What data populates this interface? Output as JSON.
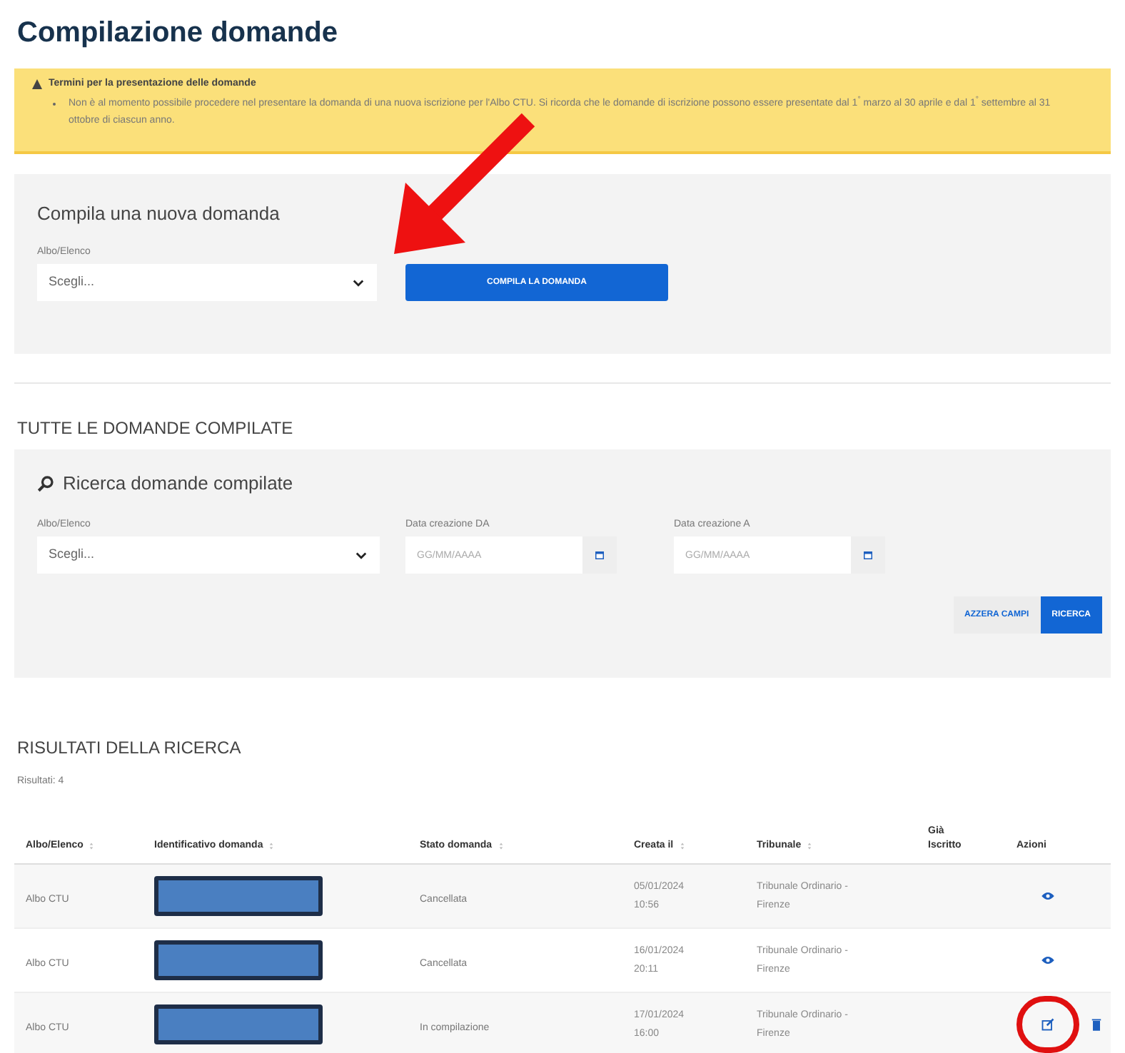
{
  "page_title": "Compilazione domande",
  "notice": {
    "title": "Termini per la presentazione delle domande",
    "text": "Non è al momento possibile procedere nel presentare la domanda di una nuova iscrizione per l'Albo CTU. Si ricorda che le domande di iscrizione possono essere presentate dal 1$^{°}$ marzo al 30 aprile e dal 1$^{°}$ settembre al 31 ottobre di ciascun anno."
  },
  "new_form": {
    "title": "Compila una nuova domanda",
    "select_label": "Albo/Elenco",
    "select_value": "Scegli...",
    "button": "COMPILA LA DOMANDA"
  },
  "search_section_title": "TUTTE LE DOMANDE COMPILATE",
  "search": {
    "title": "Ricerca domande compilate",
    "fields": [
      {
        "kind": "select",
        "label": "Albo/Elenco",
        "value": "Scegli..."
      },
      {
        "kind": "date",
        "label": "Data creazione DA",
        "placeholder": "GG/MM/AAAA"
      },
      {
        "kind": "date",
        "label": "Data creazione A",
        "placeholder": "GG/MM/AAAA"
      }
    ],
    "buttons": [
      {
        "label": "AZZERA CAMPI",
        "kind": "secondary"
      },
      {
        "label": "RICERCA",
        "kind": "primary"
      }
    ]
  },
  "results": {
    "title": "RISULTATI DELLA RICERCA",
    "count": "Risultati: 4",
    "columns": [
      {
        "label": "Albo/Elenco",
        "sortable": true
      },
      {
        "label": "Identificativo domanda",
        "sortable": true
      },
      {
        "label": "Stato domanda",
        "sortable": true
      },
      {
        "label": "Creata il",
        "sortable": true
      },
      {
        "label": "Tribunale",
        "sortable": true
      },
      {
        "label": "Già Iscritto",
        "sortable": false
      },
      {
        "label": "Azioni",
        "sortable": false
      }
    ],
    "rows": [
      {
        "albo": "Albo CTU",
        "id_redacted": true,
        "stato": "Cancellata",
        "creata": "05/01/2024 10:56",
        "tribunale": "Tribunale Ordinario - Firenze",
        "actions": [
          {
            "kind": "view",
            "circled": false
          }
        ]
      },
      {
        "albo": "Albo CTU",
        "id_redacted": true,
        "stato": "Cancellata",
        "creata": "16/01/2024 20:11",
        "tribunale": "Tribunale Ordinario - Firenze",
        "actions": [
          {
            "kind": "view",
            "circled": false
          }
        ]
      },
      {
        "albo": "Albo CTU",
        "id_redacted": true,
        "stato": "In compilazione",
        "creata": "17/01/2024 16:00",
        "tribunale": "Tribunale Ordinario - Firenze",
        "actions": [
          {
            "kind": "edit",
            "circled": true
          },
          {
            "kind": "delete",
            "circled": false
          }
        ]
      }
    ]
  },
  "pointer_arrow": true
}
